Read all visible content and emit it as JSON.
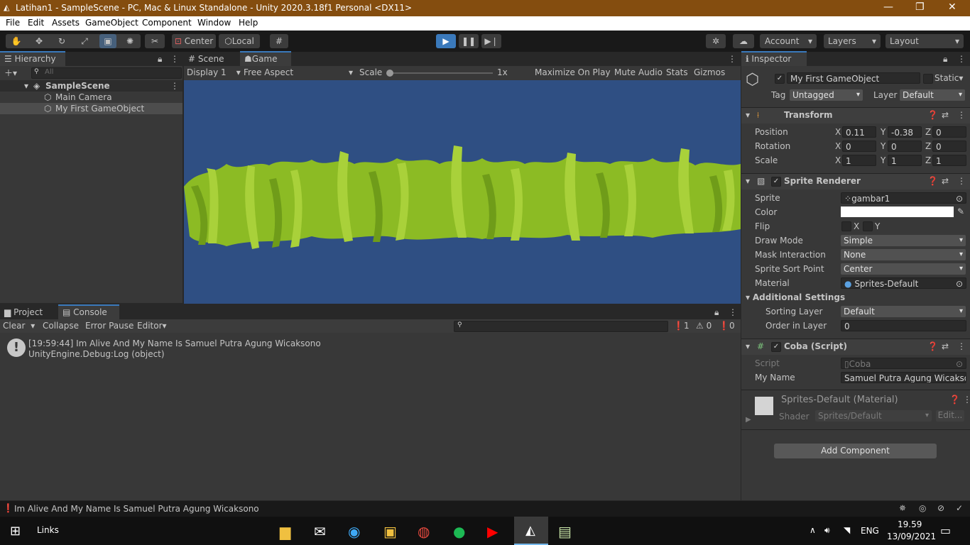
{
  "window": {
    "title": "Latihan1 - SampleScene - PC, Mac & Linux Standalone - Unity 2020.3.18f1 Personal <DX11>"
  },
  "menu": [
    "File",
    "Edit",
    "Assets",
    "GameObject",
    "Component",
    "Window",
    "Help"
  ],
  "toolbar": {
    "center": "Center",
    "local": "Local",
    "account": "Account",
    "layers": "Layers",
    "layout": "Layout"
  },
  "hierarchy": {
    "tab": "Hierarchy",
    "search_placeholder": "All",
    "scene": "SampleScene",
    "items": [
      "Main Camera",
      "My First GameObject"
    ]
  },
  "view": {
    "tabs": [
      "Scene",
      "Game"
    ],
    "display": "Display 1",
    "aspect": "Free Aspect",
    "scale_label": "Scale",
    "scale_value": "1x",
    "buttons": [
      "Maximize On Play",
      "Mute Audio",
      "Stats",
      "Gizmos"
    ],
    "background_color": "#2f4f83"
  },
  "console": {
    "tabs": [
      "Project",
      "Console"
    ],
    "buttons": {
      "clear": "Clear",
      "collapse": "Collapse",
      "error_pause": "Error Pause",
      "editor": "Editor"
    },
    "counts": {
      "logs": "1",
      "warnings": "0",
      "errors": "0"
    },
    "entry_line1": "[19:59:44] Im Alive And My Name Is Samuel Putra Agung Wicaksono",
    "entry_line2": "UnityEngine.Debug:Log (object)"
  },
  "inspector": {
    "tab": "Inspector",
    "name": "My First GameObject",
    "static": "Static",
    "tag_label": "Tag",
    "tag": "Untagged",
    "layer_label": "Layer",
    "layer": "Default",
    "transform": {
      "title": "Transform",
      "position_label": "Position",
      "position": {
        "x": "0.11",
        "y": "-0.38",
        "z": "0"
      },
      "rotation_label": "Rotation",
      "rotation": {
        "x": "0",
        "y": "0",
        "z": "0"
      },
      "scale_label": "Scale",
      "scale": {
        "x": "1",
        "y": "1",
        "z": "1"
      }
    },
    "sprite_renderer": {
      "title": "Sprite Renderer",
      "sprite_label": "Sprite",
      "sprite": "gambar1",
      "color_label": "Color",
      "flip_label": "Flip",
      "flip_x": "X",
      "flip_y": "Y",
      "draw_mode_label": "Draw Mode",
      "draw_mode": "Simple",
      "mask_label": "Mask Interaction",
      "mask": "None",
      "sort_point_label": "Sprite Sort Point",
      "sort_point": "Center",
      "material_label": "Material",
      "material": "Sprites-Default",
      "additional": "Additional Settings",
      "sorting_layer_label": "Sorting Layer",
      "sorting_layer": "Default",
      "order_label": "Order in Layer",
      "order": "0"
    },
    "script": {
      "title": "Coba (Script)",
      "script_label": "Script",
      "script": "Coba",
      "myname_label": "My Name",
      "myname": "Samuel Putra Agung Wicakson"
    },
    "material": {
      "title": "Sprites-Default (Material)",
      "shader_label": "Shader",
      "shader": "Sprites/Default",
      "edit": "Edit..."
    },
    "add_component": "Add Component"
  },
  "status_bar": {
    "message": "Im Alive And My Name Is Samuel Putra Agung Wicaksono"
  },
  "taskbar": {
    "links": "Links",
    "lang": "ENG",
    "time": "19.59",
    "date": "13/09/2021"
  }
}
